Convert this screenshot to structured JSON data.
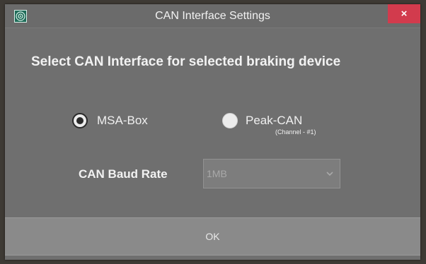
{
  "window": {
    "title": "CAN Interface Settings",
    "close_label": "×",
    "app_icon": "target-icon",
    "close_color": "#d23b4d"
  },
  "main": {
    "heading": "Select CAN Interface for selected braking device",
    "interfaces": [
      {
        "label": "MSA-Box",
        "selected": true
      },
      {
        "label": "Peak-CAN",
        "sublabel": "(Channel - #1)",
        "selected": false
      }
    ],
    "baud_rate": {
      "label": "CAN Baud Rate",
      "value": "1MB",
      "enabled": false
    }
  },
  "footer": {
    "ok_label": "OK"
  }
}
